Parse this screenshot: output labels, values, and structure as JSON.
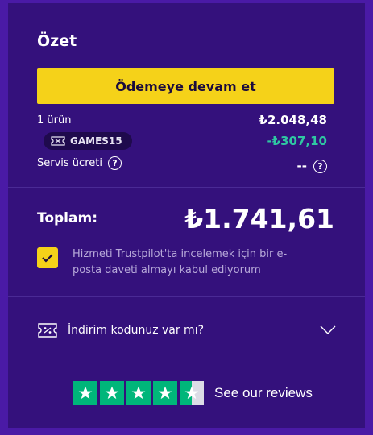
{
  "summary": {
    "title": "Özet",
    "checkout_button": "Ödemeye devam et"
  },
  "lines": {
    "items_label": "1 ürün",
    "items_value": "₺2.048,48",
    "promo_code": "GAMES15",
    "promo_value": "-₺307,10",
    "service_label": "Servis ücreti",
    "service_value": "--",
    "help_glyph": "?"
  },
  "total": {
    "label": "Toplam:",
    "value": "₺1.741,61"
  },
  "consent": {
    "checked": true,
    "text": "Hizmeti Trustpilot'ta incelemek için bir e-posta daveti almayı kabul ediyorum"
  },
  "discount": {
    "label": "İndirim kodunuz var mı?"
  },
  "trustpilot": {
    "stars": 4.5,
    "reviews_link": "See our reviews"
  },
  "colors": {
    "background": "#4a1aa6",
    "panel": "#34117c",
    "accent_yellow": "#f5d219",
    "discount_green": "#2fc7a2",
    "trustpilot_green": "#00b67a"
  }
}
